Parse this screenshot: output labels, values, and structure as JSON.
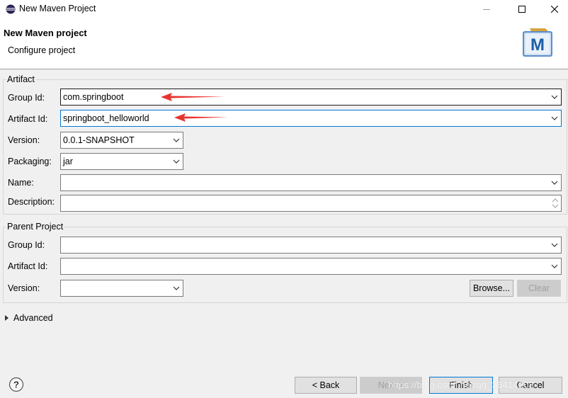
{
  "window": {
    "title": "New Maven Project"
  },
  "header": {
    "title": "New Maven project",
    "subtitle": "Configure project",
    "logo_letter": "M"
  },
  "artifact": {
    "label": "Artifact",
    "group_id": {
      "label": "Group Id:",
      "value": "com.springboot"
    },
    "artifact_id": {
      "label": "Artifact Id:",
      "value": "springboot_helloworld"
    },
    "version": {
      "label": "Version:",
      "value": "0.0.1-SNAPSHOT"
    },
    "packaging": {
      "label": "Packaging:",
      "value": "jar"
    },
    "name": {
      "label": "Name:",
      "value": ""
    },
    "description": {
      "label": "Description:",
      "value": ""
    }
  },
  "parent": {
    "label": "Parent Project",
    "group_id": {
      "label": "Group Id:",
      "value": ""
    },
    "artifact_id": {
      "label": "Artifact Id:",
      "value": ""
    },
    "version": {
      "label": "Version:",
      "value": ""
    },
    "browse_label": "Browse...",
    "clear_label": "Clear"
  },
  "advanced": {
    "label": "Advanced"
  },
  "footer": {
    "back_label": "< Back",
    "next_label": "Next >",
    "finish_label": "Finish",
    "cancel_label": "Cancel"
  },
  "watermark": "https://blog.csdn.net/qq_36414208",
  "colors": {
    "focus_border": "#0078d7",
    "annotation_arrow": "#e8342f",
    "logo_blue": "#1e5fa8"
  }
}
